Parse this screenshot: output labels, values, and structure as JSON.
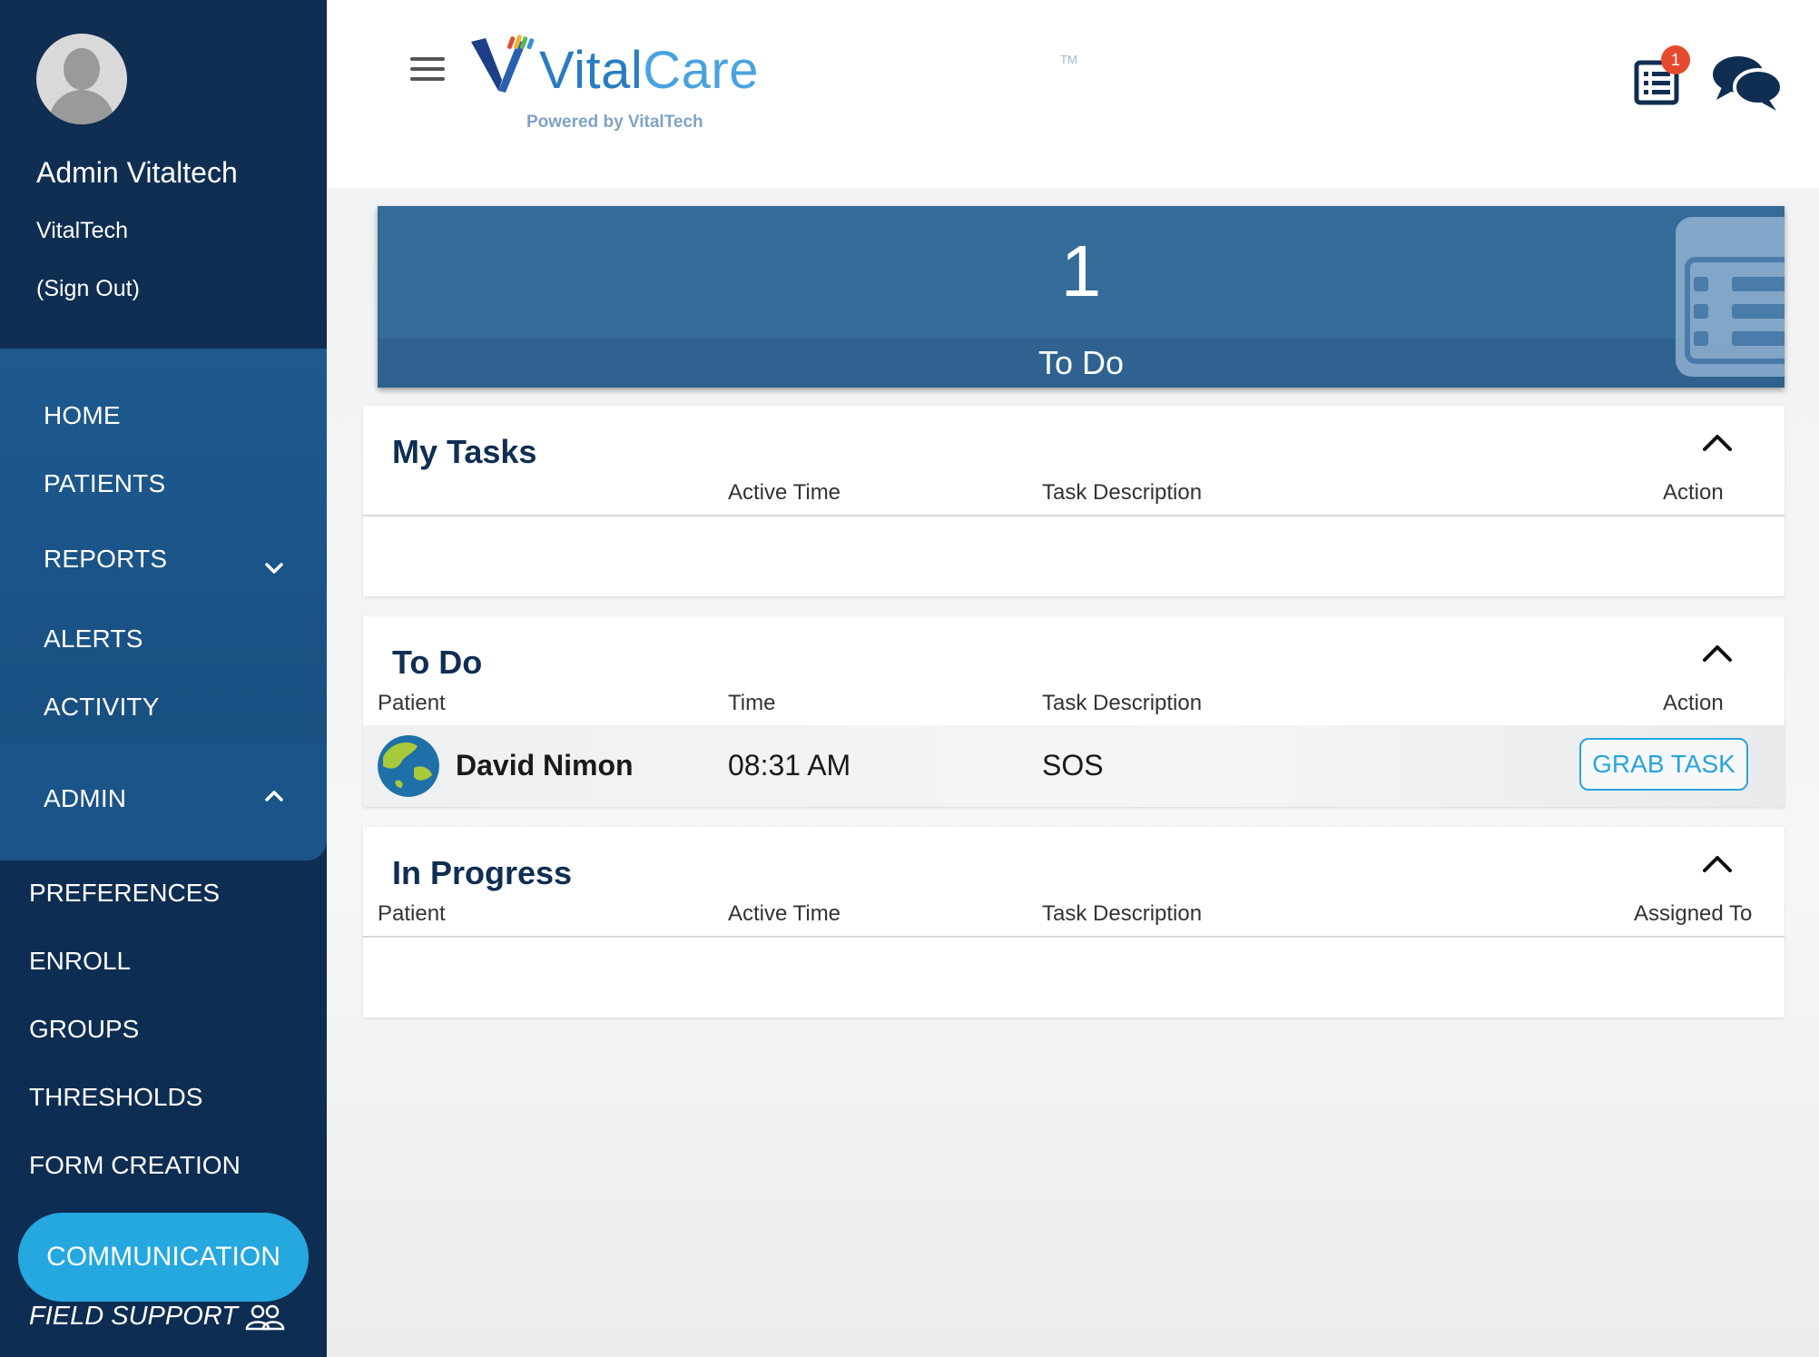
{
  "sidebar": {
    "user_name": "Admin Vitaltech",
    "org_name": "VitalTech",
    "sign_out": "(Sign Out)",
    "nav": {
      "home": "HOME",
      "patients": "PATIENTS",
      "reports": "REPORTS",
      "alerts": "ALERTS",
      "activity": "ACTIVITY",
      "admin": "ADMIN"
    },
    "admin_items": {
      "preferences": "PREFERENCES",
      "enroll": "ENROLL",
      "groups": "GROUPS",
      "thresholds": "THRESHOLDS",
      "form_creation": "FORM CREATION",
      "communication": "COMMUNICATION",
      "field_support": "FIELD SUPPORT"
    }
  },
  "header": {
    "logo_vital": "Vital",
    "logo_care": "Care",
    "logo_tm": "TM",
    "powered_by": "Powered by VitalTech",
    "task_badge": "1"
  },
  "summary": {
    "count": "1",
    "label": "To Do"
  },
  "my_tasks": {
    "title": "My Tasks",
    "columns": [
      "Active Time",
      "Task Description",
      "Action"
    ]
  },
  "todo": {
    "title": "To Do",
    "columns": [
      "Patient",
      "Time",
      "Task Description",
      "Action"
    ],
    "rows": [
      {
        "patient": "David Nimon",
        "time": "08:31 AM",
        "description": "SOS",
        "action": "GRAB TASK"
      }
    ]
  },
  "in_progress": {
    "title": "In Progress",
    "columns": [
      "Patient",
      "Active Time",
      "Task Description",
      "Assigned To"
    ]
  },
  "colors": {
    "sidebar": "#0e2d52",
    "nav_block": "#1e5a8e",
    "accent": "#25a7e0",
    "summary": "#356b98",
    "badge": "#e64a2e"
  }
}
